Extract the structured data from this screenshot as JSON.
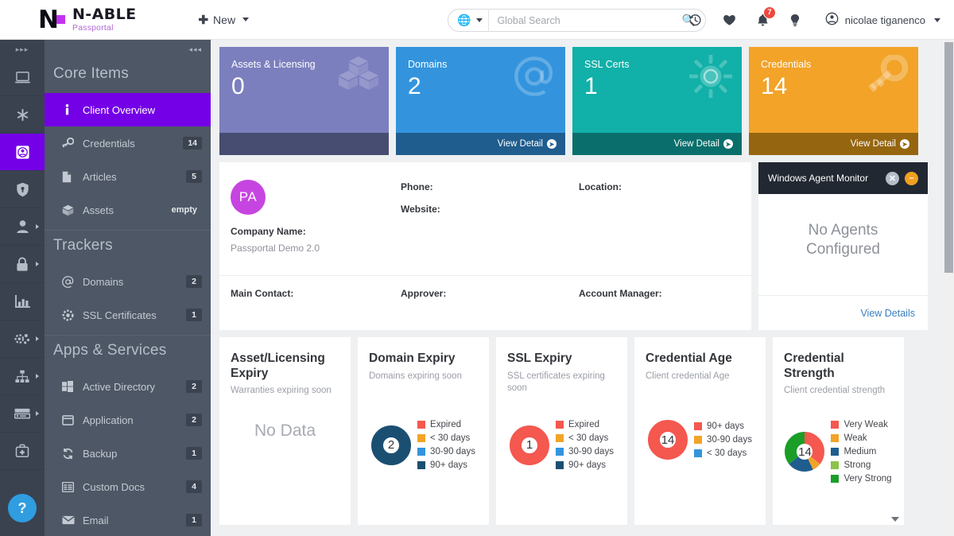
{
  "header": {
    "logo_name": "N-ABLE",
    "logo_sub": "Passportal",
    "logo_letter": "N",
    "new_label": "New",
    "new_plus": "✚",
    "search_placeholder": "Global Search",
    "search_value": "",
    "globe_icon": "globe-icon",
    "search_icon": "search-icon",
    "icons": [
      {
        "name": "history-icon",
        "glyph": "⟲"
      },
      {
        "name": "favorites-heart-icon",
        "glyph": "♥"
      },
      {
        "name": "notifications-bell-icon",
        "glyph": "🔔",
        "badge": "7"
      },
      {
        "name": "tips-lightbulb-icon",
        "glyph": "💡"
      }
    ],
    "user_name": "nicolae tiganenco",
    "user_icon": "user-avatar-icon"
  },
  "rail": {
    "expand_glyph": "▸▸▸",
    "items": [
      {
        "name": "rail-item-dashboard",
        "glyph": "▤",
        "active": false,
        "sub": false
      },
      {
        "name": "rail-item-favorites",
        "glyph": "✱",
        "active": false,
        "sub": false
      },
      {
        "name": "rail-item-clients",
        "glyph": "▣",
        "active": true,
        "sub": false
      },
      {
        "name": "rail-item-security",
        "glyph": "⛨",
        "active": false,
        "sub": false
      },
      {
        "name": "rail-item-users",
        "glyph": "👤",
        "active": false,
        "sub": true
      },
      {
        "name": "rail-item-passwords",
        "glyph": "🔒",
        "active": false,
        "sub": true
      },
      {
        "name": "rail-item-reports",
        "glyph": "📊",
        "active": false,
        "sub": false
      },
      {
        "name": "rail-item-settings",
        "glyph": "⚙",
        "active": false,
        "sub": true
      },
      {
        "name": "rail-item-org-structure",
        "glyph": "⛬",
        "active": false,
        "sub": true
      },
      {
        "name": "rail-item-devices",
        "glyph": "▬",
        "active": false,
        "sub": true
      },
      {
        "name": "rail-item-toolkit",
        "glyph": "🧰",
        "active": false,
        "sub": false
      }
    ],
    "help_label": "?"
  },
  "sidebar": {
    "collapse_glyph": "◂◂◂",
    "groups": [
      {
        "title": "Core Items",
        "items": [
          {
            "label": "Client Overview",
            "badge": "",
            "icon": "info-icon",
            "active": true
          },
          {
            "label": "Credentials",
            "badge": "14",
            "icon": "key-icon",
            "active": false
          },
          {
            "label": "Articles",
            "badge": "5",
            "icon": "document-icon",
            "active": false
          },
          {
            "label": "Assets",
            "badge": "empty",
            "icon": "box-icon",
            "active": false
          }
        ]
      },
      {
        "title": "Trackers",
        "items": [
          {
            "label": "Domains",
            "badge": "2",
            "icon": "at-sign-icon",
            "active": false
          },
          {
            "label": "SSL Certificates",
            "badge": "1",
            "icon": "gear-icon",
            "active": false
          }
        ]
      },
      {
        "title": "Apps & Services",
        "items": [
          {
            "label": "Active Directory",
            "badge": "2",
            "icon": "windows-icon",
            "active": false
          },
          {
            "label": "Application",
            "badge": "2",
            "icon": "window-icon",
            "active": false
          },
          {
            "label": "Backup",
            "badge": "1",
            "icon": "refresh-icon",
            "active": false
          },
          {
            "label": "Custom Docs",
            "badge": "4",
            "icon": "table-icon",
            "active": false
          },
          {
            "label": "Email",
            "badge": "1",
            "icon": "envelope-icon",
            "active": false
          }
        ]
      }
    ]
  },
  "stats": [
    {
      "title": "Assets & Licensing",
      "value": "0",
      "glyph": "⬡",
      "icon": "boxes-icon",
      "link": "",
      "bg": "#7b7fbe",
      "foot_bg": "#464d70",
      "has_link": false
    },
    {
      "title": "Domains",
      "value": "2",
      "glyph": "@",
      "icon": "at-sign-icon",
      "link": "View Detail",
      "bg": "#3394dd",
      "foot_bg": "#1f5d8e",
      "has_link": true
    },
    {
      "title": "SSL Certs",
      "value": "1",
      "glyph": "✺",
      "icon": "sun-gear-icon",
      "link": "View Detail",
      "bg": "#11b0a8",
      "foot_bg": "#0a6f6c",
      "has_link": true
    },
    {
      "title": "Credentials",
      "value": "14",
      "glyph": "🔑",
      "icon": "key-icon",
      "link": "View Detail",
      "bg": "#f2a328",
      "foot_bg": "#96650f",
      "has_link": true
    }
  ],
  "info": {
    "avatar_initials": "PA",
    "company_label": "Company Name:",
    "company_value": "Passportal Demo 2.0",
    "phone_label": "Phone:",
    "phone_value": "",
    "website_label": "Website:",
    "website_value": "",
    "location_label": "Location:",
    "location_value": "",
    "main_contact_label": "Main Contact:",
    "main_contact_value": "",
    "approver_label": "Approver:",
    "approver_value": "",
    "account_manager_label": "Account Manager:",
    "account_manager_value": ""
  },
  "agent": {
    "title": "Windows Agent Monitor",
    "close_glyph": "✕",
    "minimize_glyph": "–",
    "body_line1": "No Agents",
    "body_line2": "Configured",
    "link": "View Details"
  },
  "chart_data": [
    {
      "type": "pie",
      "card_name": "asset-licensing-expiry",
      "title": "Asset/Licensing Expiry",
      "subtitle": "Warranties expiring soon",
      "empty_text": "No Data",
      "total": null,
      "categories": [],
      "values": [],
      "colors": [],
      "legend_position": "right"
    },
    {
      "type": "pie",
      "card_name": "domain-expiry",
      "title": "Domain Expiry",
      "subtitle": "Domains expiring soon",
      "empty_text": "",
      "total": "2",
      "categories": [
        "Expired",
        "< 30 days",
        "30-90 days",
        "90+ days"
      ],
      "values": [
        0,
        0,
        0,
        2
      ],
      "colors": [
        "#f4584f",
        "#f2a328",
        "#3394dd",
        "#1b4f72"
      ],
      "legend_position": "right"
    },
    {
      "type": "pie",
      "card_name": "ssl-expiry",
      "title": "SSL Expiry",
      "subtitle": "SSL certificates expiring soon",
      "empty_text": "",
      "total": "1",
      "categories": [
        "Expired",
        "< 30 days",
        "30-90 days",
        "90+ days"
      ],
      "values": [
        1,
        0,
        0,
        0
      ],
      "colors": [
        "#f4584f",
        "#f2a328",
        "#3394dd",
        "#1b4f72"
      ],
      "legend_position": "right"
    },
    {
      "type": "pie",
      "card_name": "credential-age",
      "title": "Credential Age",
      "subtitle": "Client credential Age",
      "empty_text": "",
      "total": "14",
      "categories": [
        "90+ days",
        "30-90 days",
        "< 30 days"
      ],
      "values": [
        14,
        0,
        0
      ],
      "colors": [
        "#f4584f",
        "#f2a328",
        "#3394dd"
      ],
      "legend_position": "right"
    },
    {
      "type": "pie",
      "card_name": "credential-strength",
      "title": "Credential Strength",
      "subtitle": "Client credential strength",
      "empty_text": "",
      "total": "14",
      "categories": [
        "Very Weak",
        "Weak",
        "Medium",
        "Strong",
        "Very Strong"
      ],
      "values": [
        5,
        1,
        3,
        0,
        5
      ],
      "colors": [
        "#f4584f",
        "#f2a328",
        "#1f5d8e",
        "#8bc34a",
        "#1a9e28"
      ],
      "legend_position": "right"
    }
  ]
}
